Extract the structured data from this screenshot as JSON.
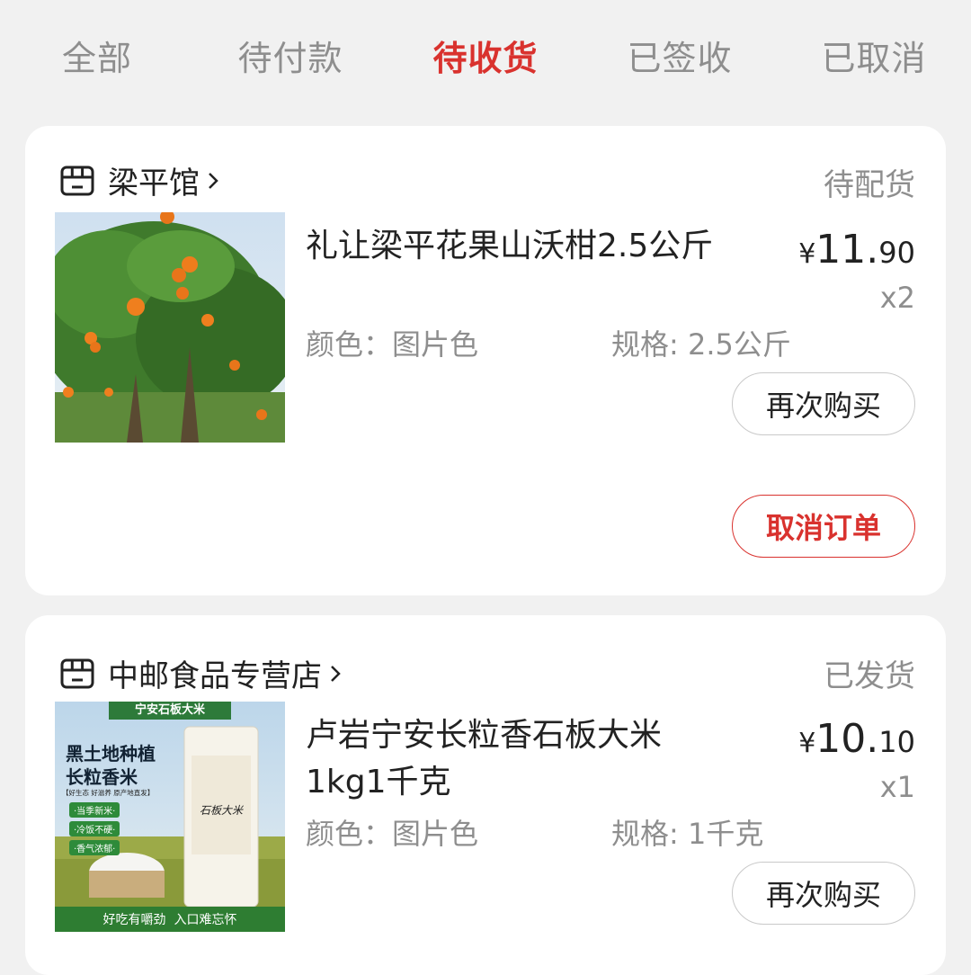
{
  "tabs": [
    {
      "label": "全部"
    },
    {
      "label": "待付款"
    },
    {
      "label": "待收货"
    },
    {
      "label": "已签收"
    },
    {
      "label": "已取消"
    }
  ],
  "active_tab": 2,
  "orders": [
    {
      "shop": "梁平馆",
      "status": "待配货",
      "product_title": "礼让梁平花果山沃柑2.5公斤",
      "price_currency": "¥",
      "price_int": "11.",
      "price_dec": "90",
      "qty": "x2",
      "color_attr": "颜色：图片色",
      "spec_attr": "规格: 2.5公斤",
      "rebuy_label": "再次购买",
      "cancel_label": "取消订单"
    },
    {
      "shop": "中邮食品专营店",
      "status": "已发货",
      "product_title_line1": "卢岩宁安长粒香石板大米",
      "product_title_line2": "1kg1千克",
      "price_currency": "¥",
      "price_int": "10.",
      "price_dec": "10",
      "qty": "x1",
      "color_attr": "颜色：图片色",
      "spec_attr": "规格: 1千克",
      "rebuy_label": "再次购买",
      "rice_pack": {
        "banner": "宁安石板大米",
        "headline1": "黑土地种植",
        "headline2": "长粒香米",
        "subline": "【好生态 好滋养 原产地直发】",
        "tags": [
          "·当季新米·",
          "·冷饭不硬·",
          "·香气浓郁·"
        ],
        "bag_label": "石板大米",
        "footer": "好吃有嚼劲  入口难忘怀"
      }
    }
  ],
  "colors": {
    "accent": "#d9322e",
    "muted": "#8e8e8e",
    "background": "#f1f1f1"
  },
  "icons": [
    "store-icon",
    "chevron-right-icon"
  ]
}
